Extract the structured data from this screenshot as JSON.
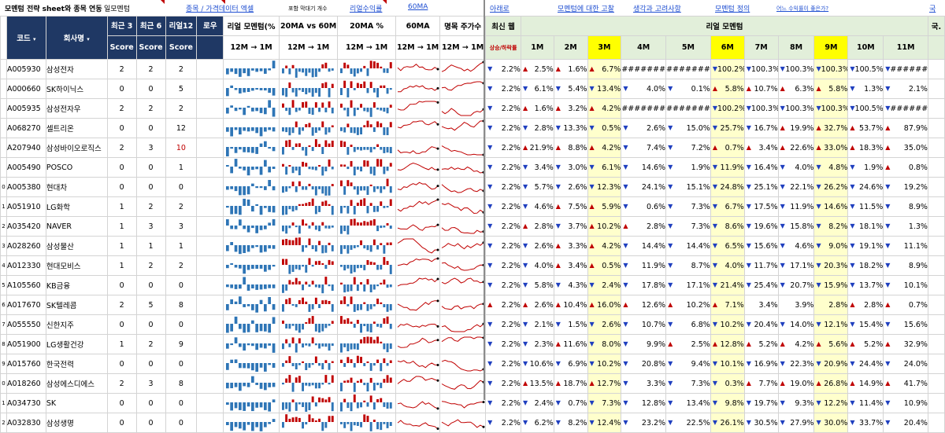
{
  "topbar": {
    "title": "모멘텀 전략 sheet와 종목 연동",
    "tag": "일모멘텀",
    "link_ticker": "종목 / 가격데이터 엑셀",
    "small_note": "포함 막대기 개수",
    "link_real_return": "리얼수익률",
    "link_60ma": "60MA",
    "link_down": "아래로",
    "link_momentum": "모멘텀에 대한 고찰",
    "link_thoughts": "생각과 고려사항",
    "link_definition": "모멘텀 정의",
    "link_which": "어느 수익률이 좋은가?",
    "link_edge": "국"
  },
  "headers": {
    "code": "코드",
    "name": "회사명",
    "recent3": "최근 3",
    "recent6": "최근 6",
    "real12": "리얼12",
    "low": "로우",
    "score": "Score",
    "real_momentum_spark": "리얼 모멘텀(%",
    "ma_vs": "20MA vs 60M",
    "ma_pct": "20MA %",
    "ma60": "60MA",
    "period_price": "명목 주가수",
    "range_12m_1m": "12M → 1M",
    "recent_week": "최신 웹",
    "rise_fall": "상승/하락률",
    "real_momentum_title": "리얼 모멘텀",
    "months": [
      "1M",
      "2M",
      "3M",
      "4M",
      "5M",
      "6M",
      "7M",
      "8M",
      "9M",
      "10M",
      "11M"
    ],
    "edge_col": "국."
  },
  "colors": {
    "navy": "#1f3864",
    "highlight_yellow": "#ffff00",
    "pale_yellow": "#ffffcc",
    "header_green": "#e2efda",
    "up_red": "#c00000",
    "down_blue": "#1f3fbf",
    "bar_blue": "#2e75b6",
    "line_red": "#c00000"
  },
  "rows": [
    {
      "num": "",
      "code": "A005930",
      "name": "삼성전자",
      "s3": "2",
      "s6": "2",
      "r12": "2",
      "r12_red": false,
      "wk": {
        "d": "dn",
        "v": "2.2%"
      },
      "m": [
        [
          "up",
          "2.5%"
        ],
        [
          "up",
          "1.6%"
        ],
        [
          "up",
          "6.7%"
        ],
        [
          "",
          "#######"
        ],
        [
          "",
          "#######"
        ],
        [
          "dn",
          "100.2%"
        ],
        [
          "dn",
          "100.3%"
        ],
        [
          "dn",
          "100.3%"
        ],
        [
          "dn",
          "100.3%"
        ],
        [
          "dn",
          "100.5%"
        ],
        [
          "dn",
          "#######"
        ]
      ]
    },
    {
      "num": "",
      "code": "A000660",
      "name": "SK하이닉스",
      "s3": "0",
      "s6": "0",
      "r12": "5",
      "r12_red": false,
      "wk": {
        "d": "dn",
        "v": "2.2%"
      },
      "m": [
        [
          "dn",
          "6.1%"
        ],
        [
          "dn",
          "5.4%"
        ],
        [
          "dn",
          "13.4%"
        ],
        [
          "dn",
          "4.0%"
        ],
        [
          "dn",
          "0.1%"
        ],
        [
          "up",
          "5.8%"
        ],
        [
          "up",
          "10.7%"
        ],
        [
          "up",
          "6.3%"
        ],
        [
          "up",
          "5.8%"
        ],
        [
          "dn",
          "1.3%"
        ],
        [
          "dn",
          "2.1%"
        ]
      ]
    },
    {
      "num": "",
      "code": "A005935",
      "name": "삼성전자우",
      "s3": "2",
      "s6": "2",
      "r12": "2",
      "r12_red": false,
      "wk": {
        "d": "dn",
        "v": "2.2%"
      },
      "m": [
        [
          "up",
          "1.6%"
        ],
        [
          "up",
          "3.2%"
        ],
        [
          "up",
          "4.2%"
        ],
        [
          "",
          "#######"
        ],
        [
          "",
          "#######"
        ],
        [
          "dn",
          "100.2%"
        ],
        [
          "dn",
          "100.3%"
        ],
        [
          "dn",
          "100.3%"
        ],
        [
          "dn",
          "100.3%"
        ],
        [
          "dn",
          "100.5%"
        ],
        [
          "dn",
          "#######"
        ]
      ]
    },
    {
      "num": "",
      "code": "A068270",
      "name": "셀트리온",
      "s3": "0",
      "s6": "0",
      "r12": "12",
      "r12_red": false,
      "wk": {
        "d": "dn",
        "v": "2.2%"
      },
      "m": [
        [
          "dn",
          "2.8%"
        ],
        [
          "dn",
          "13.3%"
        ],
        [
          "dn",
          "0.5%"
        ],
        [
          "dn",
          "2.6%"
        ],
        [
          "dn",
          "15.0%"
        ],
        [
          "dn",
          "25.7%"
        ],
        [
          "dn",
          "16.7%"
        ],
        [
          "up",
          "19.9%"
        ],
        [
          "up",
          "32.7%"
        ],
        [
          "up",
          "53.7%"
        ],
        [
          "up",
          "87.9%"
        ]
      ]
    },
    {
      "num": "",
      "code": "A207940",
      "name": "삼성바이오로직스",
      "s3": "2",
      "s6": "3",
      "r12": "10",
      "r12_red": true,
      "wk": {
        "d": "dn",
        "v": "2.2%"
      },
      "m": [
        [
          "up",
          "21.9%"
        ],
        [
          "up",
          "8.8%"
        ],
        [
          "up",
          "4.2%"
        ],
        [
          "dn",
          "7.4%"
        ],
        [
          "dn",
          "7.2%"
        ],
        [
          "up",
          "0.7%"
        ],
        [
          "up",
          "3.4%"
        ],
        [
          "up",
          "22.6%"
        ],
        [
          "up",
          "33.0%"
        ],
        [
          "up",
          "18.3%"
        ],
        [
          "up",
          "35.0%"
        ]
      ]
    },
    {
      "num": "",
      "code": "A005490",
      "name": "POSCO",
      "s3": "0",
      "s6": "0",
      "r12": "1",
      "r12_red": false,
      "wk": {
        "d": "dn",
        "v": "2.2%"
      },
      "m": [
        [
          "dn",
          "3.4%"
        ],
        [
          "dn",
          "3.0%"
        ],
        [
          "dn",
          "6.1%"
        ],
        [
          "dn",
          "14.6%"
        ],
        [
          "dn",
          "1.9%"
        ],
        [
          "dn",
          "11.9%"
        ],
        [
          "dn",
          "16.4%"
        ],
        [
          "dn",
          "4.0%"
        ],
        [
          "dn",
          "4.8%"
        ],
        [
          "dn",
          "1.9%"
        ],
        [
          "up",
          "0.8%"
        ]
      ]
    },
    {
      "num": "0",
      "code": "A005380",
      "name": "현대차",
      "s3": "0",
      "s6": "0",
      "r12": "0",
      "r12_red": false,
      "wk": {
        "d": "dn",
        "v": "2.2%"
      },
      "m": [
        [
          "dn",
          "5.7%"
        ],
        [
          "dn",
          "2.6%"
        ],
        [
          "dn",
          "12.3%"
        ],
        [
          "dn",
          "24.1%"
        ],
        [
          "dn",
          "15.1%"
        ],
        [
          "dn",
          "24.8%"
        ],
        [
          "dn",
          "25.1%"
        ],
        [
          "dn",
          "22.1%"
        ],
        [
          "dn",
          "26.2%"
        ],
        [
          "dn",
          "24.6%"
        ],
        [
          "dn",
          "19.2%"
        ]
      ]
    },
    {
      "num": "1",
      "code": "A051910",
      "name": "LG화학",
      "s3": "1",
      "s6": "2",
      "r12": "2",
      "r12_red": false,
      "wk": {
        "d": "dn",
        "v": "2.2%"
      },
      "m": [
        [
          "dn",
          "4.6%"
        ],
        [
          "up",
          "7.5%"
        ],
        [
          "up",
          "5.9%"
        ],
        [
          "dn",
          "0.6%"
        ],
        [
          "dn",
          "7.3%"
        ],
        [
          "dn",
          "6.7%"
        ],
        [
          "dn",
          "17.5%"
        ],
        [
          "dn",
          "11.9%"
        ],
        [
          "dn",
          "14.6%"
        ],
        [
          "dn",
          "11.5%"
        ],
        [
          "dn",
          "8.9%"
        ]
      ]
    },
    {
      "num": "2",
      "code": "A035420",
      "name": "NAVER",
      "s3": "1",
      "s6": "3",
      "r12": "3",
      "r12_red": false,
      "wk": {
        "d": "dn",
        "v": "2.2%"
      },
      "m": [
        [
          "up",
          "2.8%"
        ],
        [
          "dn",
          "3.7%"
        ],
        [
          "up",
          "10.2%"
        ],
        [
          "up",
          "2.8%"
        ],
        [
          "dn",
          "7.3%"
        ],
        [
          "dn",
          "8.6%"
        ],
        [
          "dn",
          "19.6%"
        ],
        [
          "dn",
          "15.8%"
        ],
        [
          "dn",
          "8.2%"
        ],
        [
          "dn",
          "18.1%"
        ],
        [
          "dn",
          "1.3%"
        ]
      ]
    },
    {
      "num": "3",
      "code": "A028260",
      "name": "삼성물산",
      "s3": "1",
      "s6": "1",
      "r12": "1",
      "r12_red": false,
      "wk": {
        "d": "dn",
        "v": "2.2%"
      },
      "m": [
        [
          "dn",
          "2.6%"
        ],
        [
          "up",
          "3.3%"
        ],
        [
          "up",
          "4.2%"
        ],
        [
          "dn",
          "14.4%"
        ],
        [
          "dn",
          "14.4%"
        ],
        [
          "dn",
          "6.5%"
        ],
        [
          "dn",
          "15.6%"
        ],
        [
          "dn",
          "4.6%"
        ],
        [
          "dn",
          "9.0%"
        ],
        [
          "dn",
          "19.1%"
        ],
        [
          "dn",
          "11.1%"
        ]
      ]
    },
    {
      "num": "4",
      "code": "A012330",
      "name": "현대모비스",
      "s3": "1",
      "s6": "2",
      "r12": "2",
      "r12_red": false,
      "wk": {
        "d": "dn",
        "v": "2.2%"
      },
      "m": [
        [
          "dn",
          "4.0%"
        ],
        [
          "up",
          "3.4%"
        ],
        [
          "up",
          "0.5%"
        ],
        [
          "dn",
          "11.9%"
        ],
        [
          "dn",
          "8.7%"
        ],
        [
          "dn",
          "4.0%"
        ],
        [
          "dn",
          "11.7%"
        ],
        [
          "dn",
          "17.1%"
        ],
        [
          "dn",
          "20.3%"
        ],
        [
          "dn",
          "18.2%"
        ],
        [
          "dn",
          "8.9%"
        ]
      ]
    },
    {
      "num": "5",
      "code": "A105560",
      "name": "KB금융",
      "s3": "0",
      "s6": "0",
      "r12": "0",
      "r12_red": false,
      "wk": {
        "d": "dn",
        "v": "2.2%"
      },
      "m": [
        [
          "dn",
          "5.8%"
        ],
        [
          "dn",
          "4.3%"
        ],
        [
          "dn",
          "2.4%"
        ],
        [
          "dn",
          "17.8%"
        ],
        [
          "dn",
          "17.1%"
        ],
        [
          "dn",
          "21.4%"
        ],
        [
          "dn",
          "25.4%"
        ],
        [
          "dn",
          "20.7%"
        ],
        [
          "dn",
          "15.9%"
        ],
        [
          "dn",
          "13.7%"
        ],
        [
          "dn",
          "10.1%"
        ]
      ]
    },
    {
      "num": "6",
      "code": "A017670",
      "name": "SK텔레콤",
      "s3": "2",
      "s6": "5",
      "r12": "8",
      "r12_red": false,
      "wk": {
        "d": "up",
        "v": "2.2%"
      },
      "m": [
        [
          "up",
          "2.6%"
        ],
        [
          "up",
          "10.4%"
        ],
        [
          "up",
          "16.0%"
        ],
        [
          "up",
          "12.6%"
        ],
        [
          "up",
          "10.2%"
        ],
        [
          "up",
          "7.1%"
        ],
        [
          "",
          "3.4%"
        ],
        [
          "",
          "3.9%"
        ],
        [
          "",
          "2.8%"
        ],
        [
          "up",
          "2.8%"
        ],
        [
          "up",
          "0.7%"
        ]
      ]
    },
    {
      "num": "7",
      "code": "A055550",
      "name": "신한지주",
      "s3": "0",
      "s6": "0",
      "r12": "0",
      "r12_red": false,
      "wk": {
        "d": "dn",
        "v": "2.2%"
      },
      "m": [
        [
          "dn",
          "2.1%"
        ],
        [
          "dn",
          "1.5%"
        ],
        [
          "dn",
          "2.6%"
        ],
        [
          "dn",
          "10.7%"
        ],
        [
          "dn",
          "6.8%"
        ],
        [
          "dn",
          "10.2%"
        ],
        [
          "dn",
          "20.4%"
        ],
        [
          "dn",
          "14.0%"
        ],
        [
          "dn",
          "12.1%"
        ],
        [
          "dn",
          "15.4%"
        ],
        [
          "dn",
          "15.6%"
        ]
      ]
    },
    {
      "num": "8",
      "code": "A051900",
      "name": "LG생활건강",
      "s3": "1",
      "s6": "2",
      "r12": "9",
      "r12_red": false,
      "wk": {
        "d": "dn",
        "v": "2.2%"
      },
      "m": [
        [
          "dn",
          "2.3%"
        ],
        [
          "up",
          "11.6%"
        ],
        [
          "dn",
          "8.0%"
        ],
        [
          "dn",
          "9.9%"
        ],
        [
          "up",
          "2.5%"
        ],
        [
          "up",
          "12.8%"
        ],
        [
          "up",
          "5.2%"
        ],
        [
          "up",
          "4.2%"
        ],
        [
          "up",
          "5.6%"
        ],
        [
          "up",
          "5.2%"
        ],
        [
          "up",
          "32.9%"
        ]
      ]
    },
    {
      "num": "9",
      "code": "A015760",
      "name": "한국전력",
      "s3": "0",
      "s6": "0",
      "r12": "0",
      "r12_red": false,
      "wk": {
        "d": "dn",
        "v": "2.2%"
      },
      "m": [
        [
          "dn",
          "10.6%"
        ],
        [
          "dn",
          "6.9%"
        ],
        [
          "dn",
          "10.2%"
        ],
        [
          "dn",
          "20.8%"
        ],
        [
          "dn",
          "9.4%"
        ],
        [
          "dn",
          "10.1%"
        ],
        [
          "dn",
          "16.9%"
        ],
        [
          "dn",
          "22.3%"
        ],
        [
          "dn",
          "20.9%"
        ],
        [
          "dn",
          "24.4%"
        ],
        [
          "dn",
          "24.0%"
        ]
      ]
    },
    {
      "num": "0",
      "code": "A018260",
      "name": "삼성에스디에스",
      "s3": "2",
      "s6": "3",
      "r12": "8",
      "r12_red": false,
      "wk": {
        "d": "dn",
        "v": "2.2%"
      },
      "m": [
        [
          "up",
          "13.5%"
        ],
        [
          "up",
          "18.7%"
        ],
        [
          "up",
          "12.7%"
        ],
        [
          "dn",
          "3.3%"
        ],
        [
          "dn",
          "7.3%"
        ],
        [
          "dn",
          "0.3%"
        ],
        [
          "up",
          "7.7%"
        ],
        [
          "up",
          "19.0%"
        ],
        [
          "up",
          "26.8%"
        ],
        [
          "up",
          "14.9%"
        ],
        [
          "up",
          "41.7%"
        ]
      ]
    },
    {
      "num": "1",
      "code": "A034730",
      "name": "SK",
      "s3": "0",
      "s6": "0",
      "r12": "0",
      "r12_red": false,
      "wk": {
        "d": "dn",
        "v": "2.2%"
      },
      "m": [
        [
          "dn",
          "2.4%"
        ],
        [
          "dn",
          "0.7%"
        ],
        [
          "dn",
          "7.3%"
        ],
        [
          "dn",
          "12.8%"
        ],
        [
          "dn",
          "13.4%"
        ],
        [
          "dn",
          "9.8%"
        ],
        [
          "dn",
          "19.7%"
        ],
        [
          "dn",
          "9.3%"
        ],
        [
          "dn",
          "12.2%"
        ],
        [
          "dn",
          "11.4%"
        ],
        [
          "dn",
          "10.9%"
        ]
      ]
    },
    {
      "num": "2",
      "code": "A032830",
      "name": "삼성생명",
      "s3": "0",
      "s6": "0",
      "r12": "0",
      "r12_red": false,
      "wk": {
        "d": "dn",
        "v": "2.2%"
      },
      "m": [
        [
          "dn",
          "6.2%"
        ],
        [
          "dn",
          "8.2%"
        ],
        [
          "dn",
          "12.4%"
        ],
        [
          "dn",
          "23.2%"
        ],
        [
          "dn",
          "22.5%"
        ],
        [
          "dn",
          "26.1%"
        ],
        [
          "dn",
          "30.5%"
        ],
        [
          "dn",
          "27.9%"
        ],
        [
          "dn",
          "30.0%"
        ],
        [
          "dn",
          "33.7%"
        ],
        [
          "dn",
          "20.4%"
        ]
      ]
    }
  ]
}
